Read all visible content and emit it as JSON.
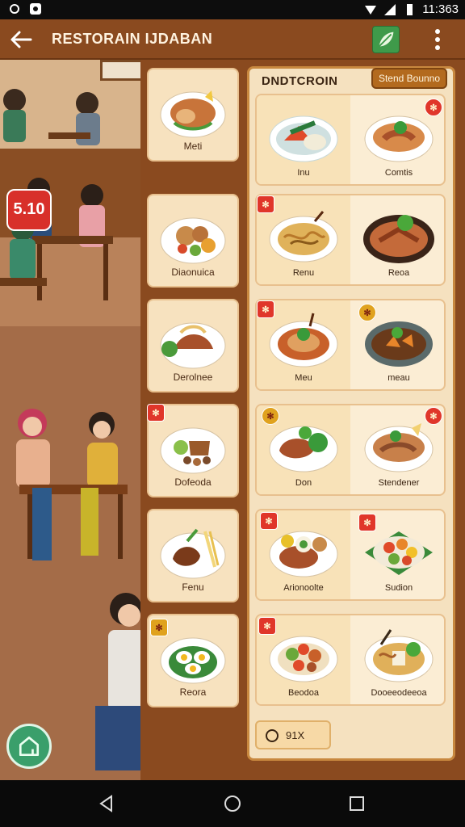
{
  "status_bar": {
    "left_icons": [
      "settings-icon",
      "app-icon"
    ],
    "right_icons": [
      "wifi-icon",
      "signal-icon",
      "battery-icon"
    ],
    "time": "11:363"
  },
  "app_bar": {
    "title": "RESTORAIN IJDABAN",
    "back_icon": "arrow-left-icon",
    "action_icon": "leaf-icon",
    "more_icon": "more-vertical-icon",
    "action_color": "#3f9a4a"
  },
  "scene": {
    "promo_badge": "5.10"
  },
  "categories": [
    {
      "label": "Meti"
    },
    {
      "label": "Diaonuica"
    },
    {
      "label": "Derolnee"
    },
    {
      "label": "Dofeoda"
    },
    {
      "label": "Fenu"
    },
    {
      "label": "Reora"
    }
  ],
  "menu": {
    "title": "DNDTCROIN",
    "pill": "Stend Bounno",
    "rows": [
      {
        "left": "Inu",
        "right": "Comtis"
      },
      {
        "left": "Renu",
        "right": "Reoa"
      },
      {
        "left": "Meu",
        "right": "meau"
      },
      {
        "left": "Don",
        "right": "Stendener"
      },
      {
        "left": "Arionoolte",
        "right": "Sudion"
      },
      {
        "left": "Beodoa",
        "right": "Dooeeodeeoa"
      }
    ],
    "search_chip": "91X"
  },
  "nav_bar": {
    "icons": [
      "back-triangle-icon",
      "home-circle-icon",
      "recents-square-icon"
    ]
  },
  "colors": {
    "accent": "#8a4a1f",
    "card": "#f7e2bf",
    "tag_red": "#e0362a",
    "tag_gold": "#e0a21e"
  }
}
